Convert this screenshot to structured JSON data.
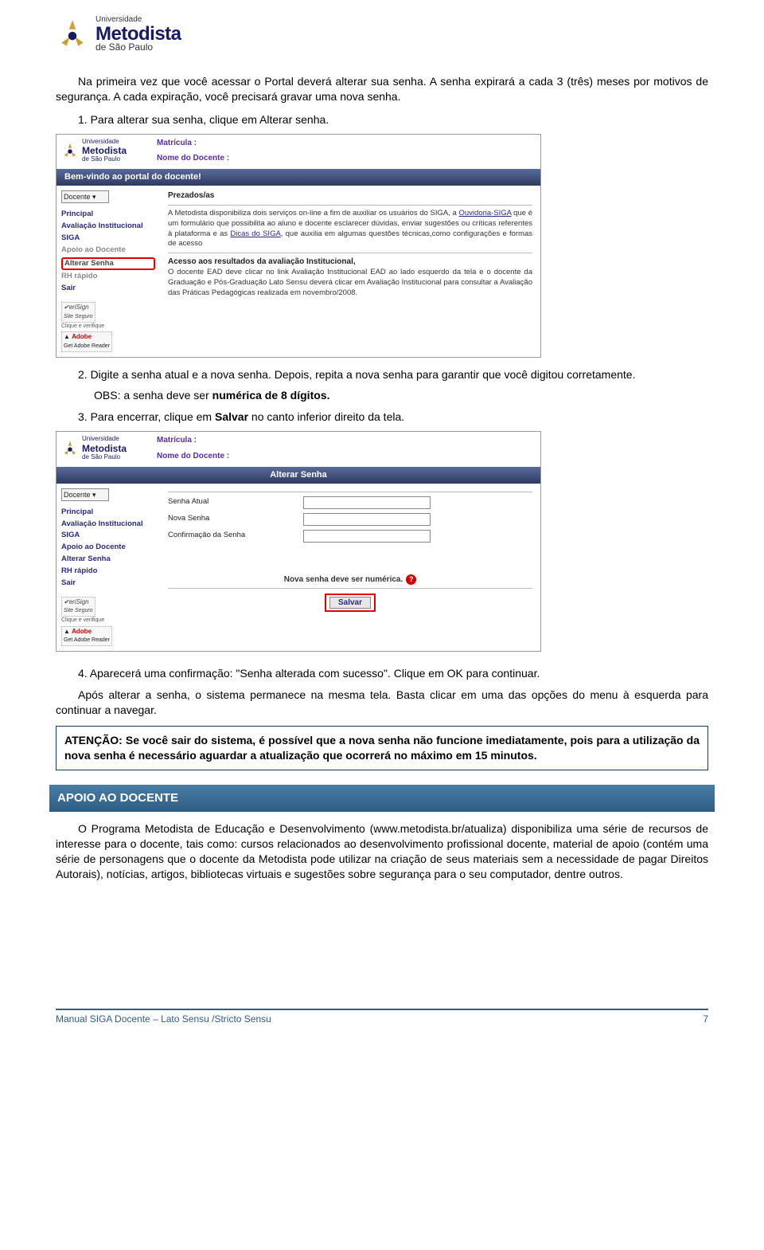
{
  "logo": {
    "universidade": "Universidade",
    "name": "Metodista",
    "sp": "de São Paulo"
  },
  "intro": "Na primeira vez que você acessar o Portal deverá alterar sua senha. A senha expirará a cada 3 (três) meses por motivos de segurança. A cada expiração, você precisará gravar uma nova senha.",
  "step1": "1. Para alterar sua senha, clique em Alterar senha.",
  "step2": "2. Digite a senha atual e a nova senha. Depois, repita a nova senha para garantir que você digitou corretamente.",
  "step2_obs_pre": "OBS: a senha deve ser ",
  "step2_obs_bold": "numérica de 8 dígitos.",
  "step3_pre": "3. Para encerrar, clique em ",
  "step3_bold": "Salvar",
  "step3_post": " no canto inferior direito da tela.",
  "step4": "4. Aparecerá uma confirmação: \"Senha alterada com sucesso\". Clique em OK para continuar.",
  "after_text": "Após alterar a senha, o sistema permanece na mesma tela. Basta clicar em uma das opções do menu à esquerda para continuar a navegar.",
  "attention": "ATENÇÃO: Se você sair do sistema, é possível que a nova senha não funcione imediatamente, pois para a utilização da nova senha é necessário aguardar a atualização que ocorrerá no máximo em 15 minutos.",
  "section_title": "APOIO AO DOCENTE",
  "apoio_para": "O Programa Metodista de Educação e Desenvolvimento (www.metodista.br/atualiza) disponibiliza uma série de recursos de interesse para o docente, tais como: cursos relacionados ao desenvolvimento profissional docente, material de apoio (contém uma série de personagens que o docente da Metodista pode utilizar na criação de seus materiais sem a necessidade de pagar Direitos Autorais), notícias, artigos, bibliotecas virtuais e sugestões sobre segurança para o seu computador, dentre outros.",
  "footer_left": "Manual SIGA Docente – Lato Sensu /Stricto Sensu",
  "footer_page": "7",
  "ss1": {
    "matricula_lbl": "Matrícula :",
    "nome_lbl": "Nome do Docente :",
    "banner": "Bem-vindo ao portal do docente!",
    "docente_sel": "Docente",
    "nav": [
      "Principal",
      "Avaliação Institucional",
      "SIGA",
      "Apoio ao Docente",
      "Alterar Senha",
      "RH rápido",
      "Sair"
    ],
    "prezados": "Prezados/as",
    "p1a": "A Metodista disponibiliza dois serviços on-line a fim de auxiliar os usuários do SIGA, a ",
    "p1_link": "Ouvidoria-SIGA",
    "p1b": " que é um formulário que possibilita ao aluno e docente esclarecer dúvidas, enviar sugestões ou críticas referentes à plataforma e as ",
    "p1_link2": "Dicas do SIGA",
    "p1c": ", que auxilia em algumas questões técnicas,como configurações e formas de acesso",
    "p2_head": "Acesso aos resultados da avaliação Institucional,",
    "p2": "O docente EAD deve clicar no link Avaliação Institucional EAD ao lado esquerdo da tela e o docente da Graduação e Pós-Graduação Lato Sensu deverá clicar em Avaliação Institucional para consultar a Avaliação das Práticas Pedagógicas realizada em novembro/2008.",
    "verisign_site": "Site Seguro",
    "verisign_clique": "Clique e verifique",
    "adobe": "Get Adobe Reader"
  },
  "ss2": {
    "matricula_lbl": "Matrícula :",
    "nome_lbl": "Nome do Docente :",
    "banner": "Alterar Senha",
    "docente_sel": "Docente",
    "nav": [
      "Principal",
      "Avaliação Institucional",
      "SIGA",
      "Apoio ao Docente",
      "Alterar Senha",
      "RH rápido",
      "Sair"
    ],
    "f1": "Senha Atual",
    "f2": "Nova Senha",
    "f3": "Confirmação da Senha",
    "note": "Nova senha deve ser numérica.",
    "salvar": "Salvar",
    "verisign_site": "Site Seguro",
    "verisign_clique": "Clique e verifique",
    "adobe": "Get Adobe Reader"
  }
}
